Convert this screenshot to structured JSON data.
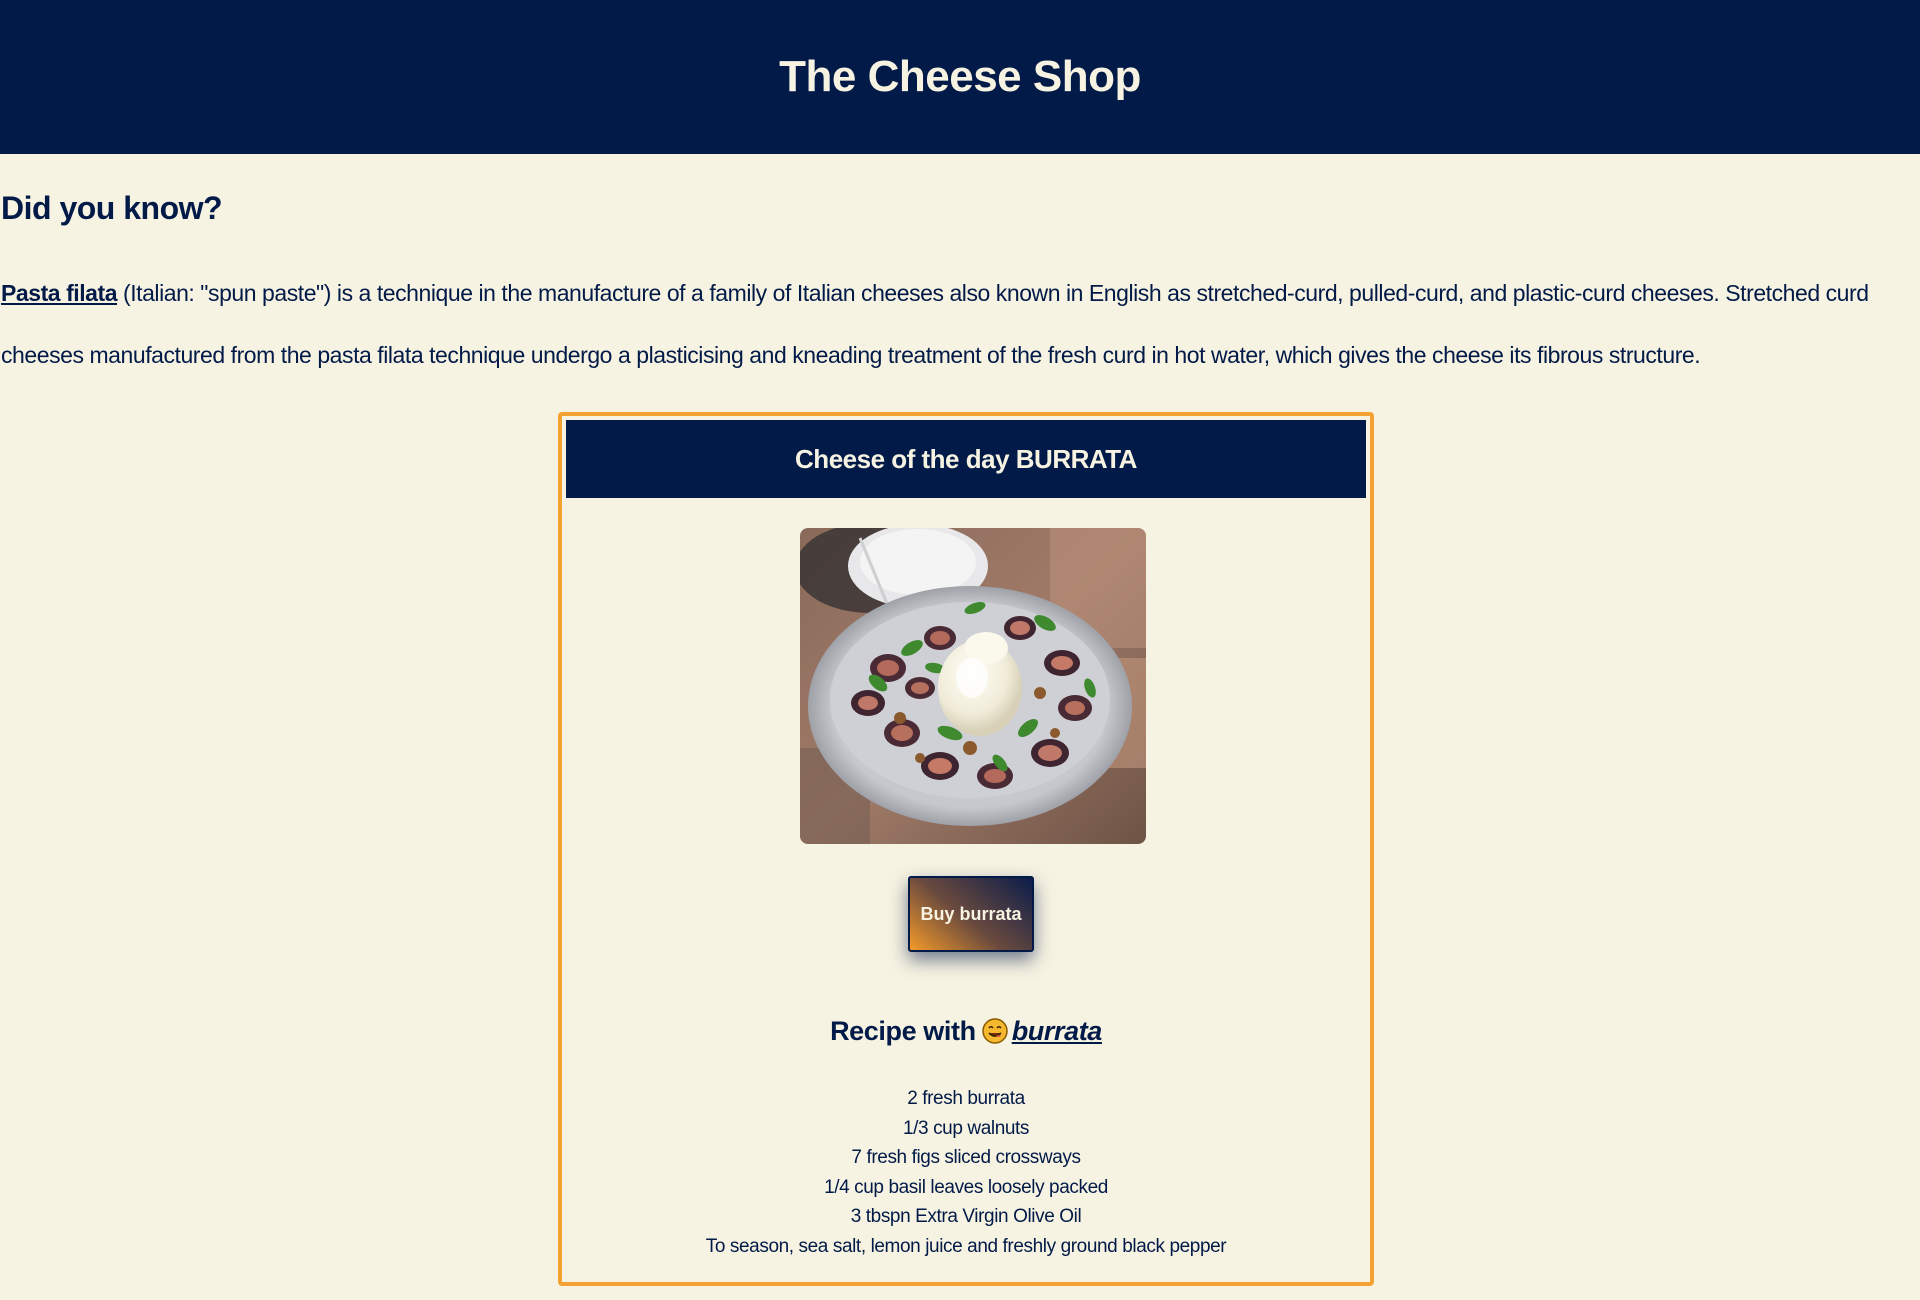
{
  "header": {
    "title": "The Cheese Shop"
  },
  "fact": {
    "heading": "Did you know?",
    "link_text": "Pasta filata",
    "body": " (Italian: \"spun paste\") is a technique in the manufacture of a family of Italian cheeses also known in English as stretched-curd, pulled-curd, and plastic-curd cheeses. Stretched curd cheeses manufactured from the pasta filata technique undergo a plasticising and kneading treatment of the fresh curd in hot water, which gives the cheese its fibrous structure."
  },
  "card": {
    "title": "Cheese of the day BURRATA",
    "image_icon": "burrata-fig-salad-photo",
    "buy_label": "Buy burrata",
    "recipe_prefix": "Recipe with",
    "recipe_emoji_icon": "yum-face-emoji-icon",
    "recipe_link": "burrata",
    "ingredients": [
      "2 fresh burrata",
      "1/3 cup walnuts",
      "7 fresh figs sliced crossways",
      "1/4 cup basil leaves loosely packed",
      "3 tbspn Extra Virgin Olive Oil",
      "To season, sea salt, lemon juice and freshly ground black pepper"
    ]
  },
  "colors": {
    "navy": "#021a48",
    "cream": "#f7f3e2",
    "accent": "#f4a233"
  }
}
